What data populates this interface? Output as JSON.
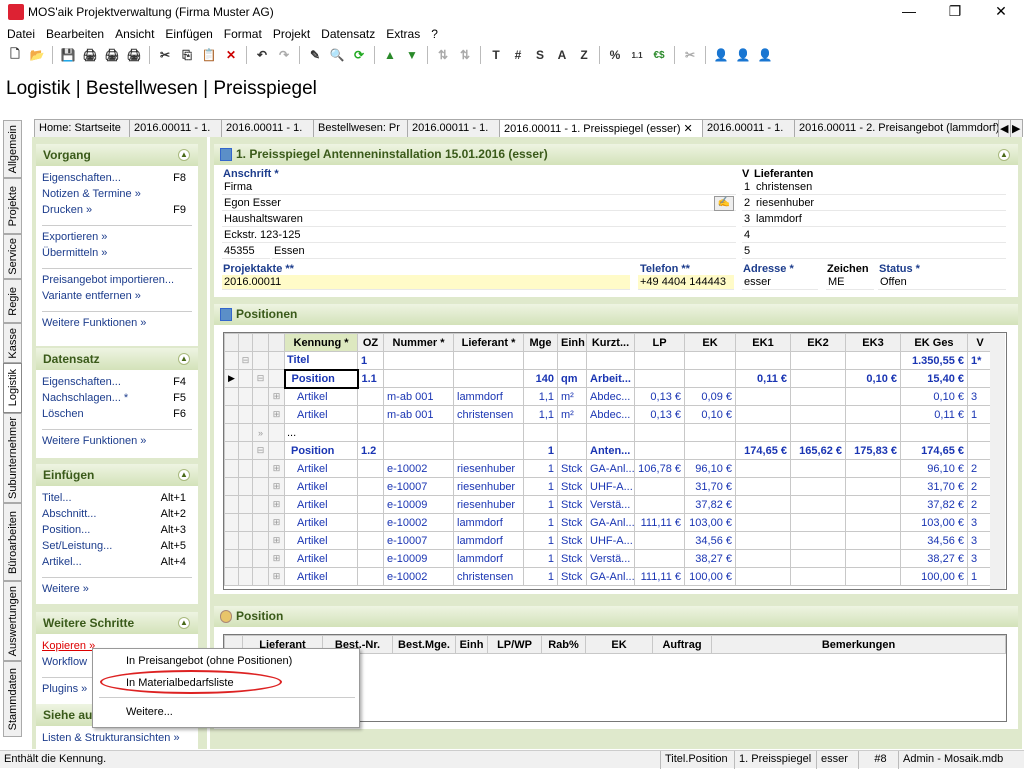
{
  "window": {
    "title": "MOS'aik Projektverwaltung (Firma Muster AG)",
    "minimize": "—",
    "maximize": "❐",
    "close": "✕"
  },
  "menu": [
    "Datei",
    "Bearbeiten",
    "Ansicht",
    "Einfügen",
    "Format",
    "Projekt",
    "Datensatz",
    "Extras",
    "?"
  ],
  "toolbar": [
    "🗋",
    "📂",
    "💾",
    "🖨",
    "🖨",
    "🖨",
    "✕",
    "✂",
    "⎘",
    "📋",
    "✕",
    "↶",
    "↷",
    "✎",
    "🔍",
    "⟳",
    "⇅",
    "⇅",
    "T",
    "#",
    "S",
    "A",
    "Z",
    "%",
    "1.1",
    "€$",
    "✂",
    "👤",
    "👤",
    "👤"
  ],
  "breadcrumb": "Logistik | Bestellwesen | Preisspiegel",
  "vtabs": [
    "Allgemein",
    "Projekte",
    "Service",
    "Regie",
    "Kasse",
    "Logistik",
    "Subunternehmer",
    "Büroarbeiten",
    "Auswertungen",
    "Stammdaten"
  ],
  "doctabs": [
    "Home: Startseite",
    "2016.00011 - 1.",
    "2016.00011 - 1.",
    "Bestellwesen: Pr",
    "2016.00011 - 1.",
    "2016.00011 - 1. Preisspiegel (esser)  ✕",
    "2016.00011 - 1.",
    "2016.00011 - 2. Preisangebot (lammdorf)"
  ],
  "tabnav": [
    "◀",
    "▶"
  ],
  "left": {
    "vorgang": {
      "title": "Vorgang",
      "items": [
        [
          "Eigenschaften...",
          "F8"
        ],
        [
          "Notizen & Termine »",
          ""
        ],
        [
          "Drucken »",
          "F9"
        ],
        [
          "Exportieren »",
          ""
        ],
        [
          "Übermitteln »",
          ""
        ],
        [
          "Preisangebot importieren...",
          ""
        ],
        [
          "Variante entfernen »",
          ""
        ],
        [
          "Weitere Funktionen »",
          ""
        ]
      ]
    },
    "datensatz": {
      "title": "Datensatz",
      "items": [
        [
          "Eigenschaften...",
          "F4"
        ],
        [
          "Nachschlagen... *",
          "F5"
        ],
        [
          "Löschen",
          "F6"
        ],
        [
          "Weitere Funktionen »",
          ""
        ]
      ]
    },
    "einfuegen": {
      "title": "Einfügen",
      "items": [
        [
          "Titel...",
          "Alt+1"
        ],
        [
          "Abschnitt...",
          "Alt+2"
        ],
        [
          "Position...",
          "Alt+3"
        ],
        [
          "Set/Leistung...",
          "Alt+5"
        ],
        [
          "Artikel...",
          "Alt+4"
        ],
        [
          "Weitere »",
          ""
        ]
      ]
    },
    "schritte": {
      "title": "Weitere Schritte",
      "items": [
        "Kopieren »",
        "Workflow",
        "Plugins »"
      ]
    },
    "siehe": {
      "title": "Siehe au",
      "items": [
        "Listen & Strukturansichten »"
      ]
    }
  },
  "header": {
    "title": "1. Preisspiegel Antenneninstallation 15.01.2016 (esser)",
    "anschrift_label": "Anschrift *",
    "anschrift": [
      "Firma",
      "Egon Esser",
      "Haushaltswaren",
      "Eckstr. 123-125"
    ],
    "plz": "45355",
    "ort": "Essen",
    "lieferanten_v": "V",
    "lieferanten_label": "Lieferanten",
    "lieferanten": [
      [
        "1",
        "christensen"
      ],
      [
        "2",
        "riesenhuber"
      ],
      [
        "3",
        "lammdorf"
      ],
      [
        "4",
        ""
      ],
      [
        "5",
        ""
      ]
    ],
    "projektakte_label": "Projektakte **",
    "projektakte": "2016.00011",
    "telefon_label": "Telefon **",
    "telefon": "+49 4404 144443",
    "adresse_label": "Adresse *",
    "adresse": "esser",
    "zeichen_label": "Zeichen",
    "zeichen": "ME",
    "status_label": "Status *",
    "status": "Offen"
  },
  "positionen": {
    "title": "Positionen",
    "columns": [
      "Kennung *",
      "OZ",
      "Nummer *",
      "Lieferant *",
      "Mge",
      "Einh",
      "Kurzt...",
      "LP",
      "EK",
      "EK1",
      "EK2",
      "EK3",
      "EK Ges",
      "V"
    ],
    "rows": [
      [
        "Titel",
        "1",
        "",
        "",
        "",
        "",
        "",
        "",
        "",
        "",
        "",
        "",
        "1.350,55 €",
        "1*"
      ],
      [
        "Position",
        "1.1",
        "",
        "",
        "140",
        "qm",
        "Arbeit...",
        "",
        "",
        "0,11 €",
        "",
        "0,10 €",
        "15,40 €",
        ""
      ],
      [
        "Artikel",
        "",
        "m-ab 001",
        "lammdorf",
        "1,1",
        "m²",
        "Abdec...",
        "0,13 €",
        "0,09 €",
        "",
        "",
        "",
        "0,10 €",
        "3"
      ],
      [
        "Artikel",
        "",
        "m-ab 001",
        "christensen",
        "1,1",
        "m²",
        "Abdec...",
        "0,13 €",
        "0,10 €",
        "",
        "",
        "",
        "0,11 €",
        "1"
      ],
      [
        "...",
        "",
        "",
        "",
        "",
        "",
        "",
        "",
        "",
        "",
        "",
        "",
        "",
        ""
      ],
      [
        "Position",
        "1.2",
        "",
        "",
        "1",
        "",
        "Anten...",
        "",
        "",
        "174,65 €",
        "165,62 €",
        "175,83 €",
        "174,65 €",
        ""
      ],
      [
        "Artikel",
        "",
        "e-10002",
        "riesenhuber",
        "1",
        "Stck",
        "GA-Anl...",
        "106,78 €",
        "96,10 €",
        "",
        "",
        "",
        "96,10 €",
        "2"
      ],
      [
        "Artikel",
        "",
        "e-10007",
        "riesenhuber",
        "1",
        "Stck",
        "UHF-A...",
        "",
        "31,70 €",
        "",
        "",
        "",
        "31,70 €",
        "2"
      ],
      [
        "Artikel",
        "",
        "e-10009",
        "riesenhuber",
        "1",
        "Stck",
        "Verstä...",
        "",
        "37,82 €",
        "",
        "",
        "",
        "37,82 €",
        "2"
      ],
      [
        "Artikel",
        "",
        "e-10002",
        "lammdorf",
        "1",
        "Stck",
        "GA-Anl...",
        "111,11 €",
        "103,00 €",
        "",
        "",
        "",
        "103,00 €",
        "3"
      ],
      [
        "Artikel",
        "",
        "e-10007",
        "lammdorf",
        "1",
        "Stck",
        "UHF-A...",
        "",
        "34,56 €",
        "",
        "",
        "",
        "34,56 €",
        "3"
      ],
      [
        "Artikel",
        "",
        "e-10009",
        "lammdorf",
        "1",
        "Stck",
        "Verstä...",
        "",
        "38,27 €",
        "",
        "",
        "",
        "38,27 €",
        "3"
      ],
      [
        "Artikel",
        "",
        "e-10002",
        "christensen",
        "1",
        "Stck",
        "GA-Anl...",
        "111,11 €",
        "100,00 €",
        "",
        "",
        "",
        "100,00 €",
        "1"
      ]
    ]
  },
  "position": {
    "title": "Position",
    "columns": [
      "Lieferant",
      "Best.-Nr.",
      "Best.Mge.",
      "Einh",
      "LP/WP",
      "Rab%",
      "EK",
      "Auftrag",
      "Bemerkungen"
    ]
  },
  "popup": {
    "items": [
      "In Preisangebot (ohne Positionen)",
      "In Materialbedarfsliste",
      "Weitere..."
    ]
  },
  "status": {
    "hint": "Enthält die Kennung.",
    "cells": [
      "Titel.Position",
      "1. Preisspiegel",
      "esser",
      "#8",
      "Admin - Mosaik.mdb"
    ]
  }
}
